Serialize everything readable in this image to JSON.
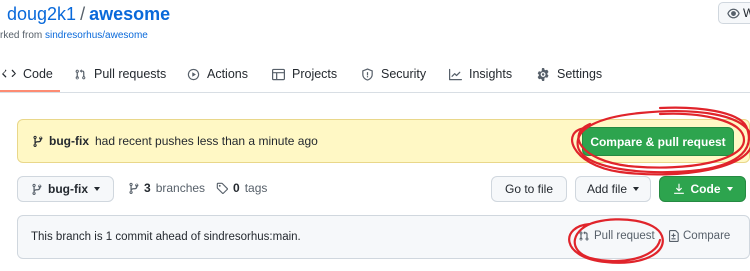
{
  "repo": {
    "owner": "doug2k1",
    "separator": "/",
    "name": "awesome",
    "fork_prefix": "rked from ",
    "fork_source": "sindresorhus/awesome"
  },
  "watch_button": {
    "label": "W",
    "icon": "eye-icon"
  },
  "tabs": [
    {
      "label": "Code",
      "icon": "code-icon",
      "selected": true
    },
    {
      "label": "Pull requests",
      "icon": "git-pull-request-icon"
    },
    {
      "label": "Actions",
      "icon": "play-icon"
    },
    {
      "label": "Projects",
      "icon": "table-icon"
    },
    {
      "label": "Security",
      "icon": "shield-icon"
    },
    {
      "label": "Insights",
      "icon": "graph-icon"
    },
    {
      "label": "Settings",
      "icon": "gear-icon"
    }
  ],
  "flash": {
    "branch": "bug-fix",
    "message": "had recent pushes less than a minute ago",
    "compare_button": "Compare & pull request"
  },
  "branch_bar": {
    "branch_select": "bug-fix",
    "branches_count": "3",
    "branches_label": "branches",
    "tags_count": "0",
    "tags_label": "tags",
    "go_to_file": "Go to file",
    "add_file": "Add file",
    "code_button": "Code"
  },
  "ahead_box": {
    "message": "This branch is 1 commit ahead of sindresorhus:main.",
    "pull_request": "Pull request",
    "compare": "Compare"
  },
  "colors": {
    "link": "#0969da",
    "primary_green": "#2da44e",
    "flash_bg": "#fff8c5",
    "annotation_red": "#e0242b",
    "tab_underline": "#fd8c73"
  }
}
